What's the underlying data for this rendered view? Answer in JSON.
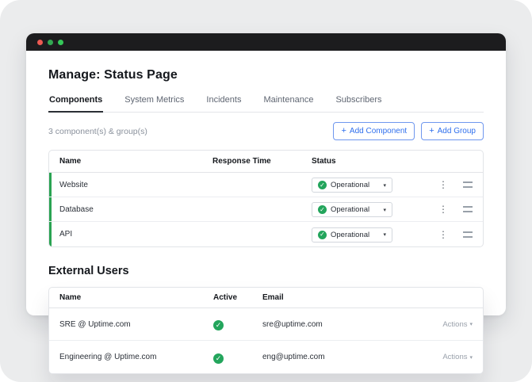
{
  "colors": {
    "accent_blue": "#2f6fed",
    "accent_green": "#23a55c",
    "row_accent_green": "#2aa352",
    "titlebar_black": "#1c1c1e",
    "traffic_red": "#ee5a52",
    "traffic_green_1": "#33a852",
    "traffic_green_2": "#35c759",
    "background_gray": "#ebeced"
  },
  "icons": {
    "check": "✓",
    "caret_down": "▾",
    "kebab": "⋮",
    "plus": "+"
  },
  "page": {
    "title": "Manage: Status Page"
  },
  "tabs": [
    {
      "label": "Components",
      "active": true
    },
    {
      "label": "System Metrics",
      "active": false
    },
    {
      "label": "Incidents",
      "active": false
    },
    {
      "label": "Maintenance",
      "active": false
    },
    {
      "label": "Subscribers",
      "active": false
    }
  ],
  "components": {
    "summary": "3 component(s) & group(s)",
    "add_component_label": "Add Component",
    "add_group_label": "Add Group",
    "table": {
      "headers": [
        "Name",
        "Response Time",
        "Status"
      ],
      "rows": [
        {
          "name": "Website",
          "response_time": "",
          "status": "Operational"
        },
        {
          "name": "Database",
          "response_time": "",
          "status": "Operational"
        },
        {
          "name": "API",
          "response_time": "",
          "status": "Operational"
        }
      ]
    }
  },
  "external_users": {
    "title": "External Users",
    "table": {
      "headers": [
        "Name",
        "Active",
        "Email"
      ],
      "actions_label": "Actions",
      "rows": [
        {
          "name": "SRE @ Uptime.com",
          "active": true,
          "email": "sre@uptime.com"
        },
        {
          "name": "Engineering @ Uptime.com",
          "active": true,
          "email": "eng@uptime.com"
        }
      ]
    }
  }
}
